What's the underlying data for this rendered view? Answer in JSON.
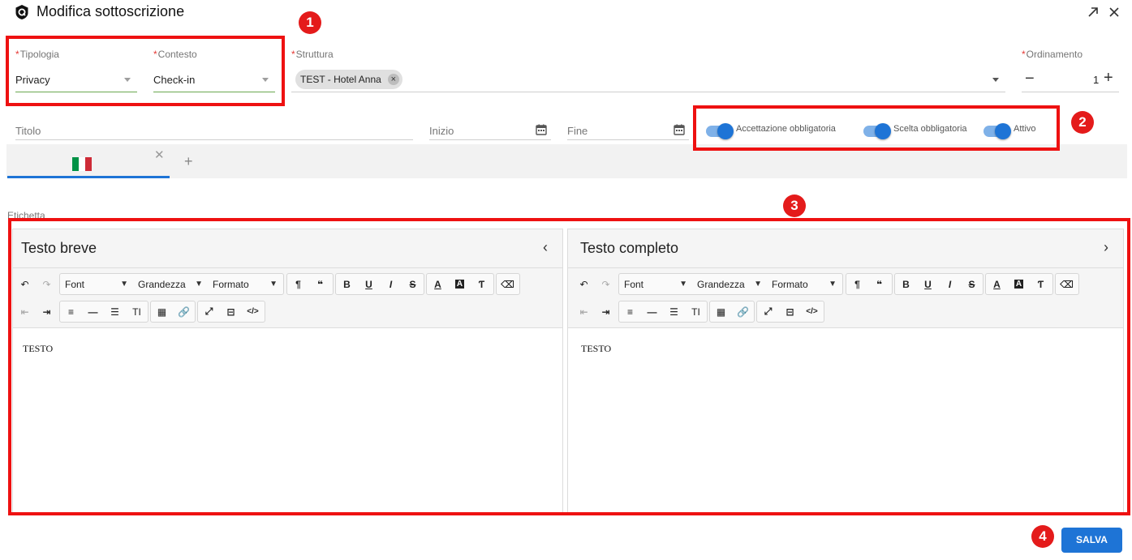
{
  "dialog": {
    "title": "Modifica sottoscrizione"
  },
  "fields": {
    "tipologia": {
      "label": "Tipologia",
      "value": "Privacy"
    },
    "contesto": {
      "label": "Contesto",
      "value": "Check-in"
    },
    "struttura": {
      "label": "Struttura",
      "chip": "TEST - Hotel Anna"
    },
    "ordinamento": {
      "label": "Ordinamento",
      "value": "1"
    },
    "titolo": {
      "placeholder": "Titolo"
    },
    "inizio": {
      "placeholder": "Inizio"
    },
    "fine": {
      "placeholder": "Fine"
    }
  },
  "toggles": [
    {
      "label": "Accettazione obbligatoria",
      "on": true
    },
    {
      "label": "Scelta obbligatoria",
      "on": true
    },
    {
      "label": "Attivo",
      "on": true
    }
  ],
  "tabs": {
    "flag_colors": [
      "#009246",
      "#ffffff",
      "#ce2b37"
    ]
  },
  "etichetta": "Etichetta",
  "editors": [
    {
      "title": "Testo breve",
      "chevron": "‹",
      "content": "TESTO",
      "font": "Font",
      "size": "Grandezza",
      "format": "Formato"
    },
    {
      "title": "Testo completo",
      "chevron": "›",
      "content": "TESTO",
      "font": "Font",
      "size": "Grandezza",
      "format": "Formato"
    }
  ],
  "annotations": [
    "1",
    "2",
    "3",
    "4"
  ],
  "buttons": {
    "save": "SALVA"
  },
  "colors": {
    "accent": "#1e74d6",
    "annotation": "#ee1111"
  }
}
